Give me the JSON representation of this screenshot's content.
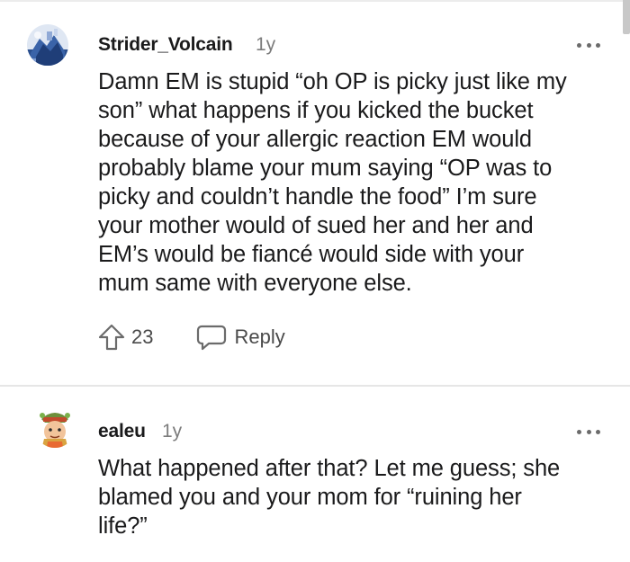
{
  "comments": [
    {
      "author": "Strider_Volcain",
      "age": "1y",
      "body_lines": [
        "Damn EM is stupid “oh OP is picky just like my",
        "son” what happens if you kicked the bucket",
        "because of your allergic reaction EM would",
        "probably blame your mum saying “OP was to",
        "picky and couldn’t handle the food” I’m sure",
        "your mother would of sued her and her and",
        "EM’s would be fiancé would side with your",
        "mum same with everyone else."
      ],
      "upvotes": "23",
      "reply_label": "Reply",
      "avatar_icon": "blue-volcano-avatar",
      "upvote_icon": "upvote-arrow-icon",
      "reply_icon": "speech-bubble-icon",
      "more_icon": "more-options-icon"
    },
    {
      "author": "ealeu",
      "age": "1y",
      "body_lines": [
        "What happened after that? Let me guess; she",
        "blamed you and your mom for “ruining her",
        "life?”"
      ],
      "avatar_icon": "cartoon-character-avatar",
      "more_icon": "more-options-icon"
    }
  ],
  "colors": {
    "text": "#1a1a1b",
    "muted": "#7c7c7c",
    "icon": "#6b6b6b",
    "divider": "#e6e6e6"
  }
}
